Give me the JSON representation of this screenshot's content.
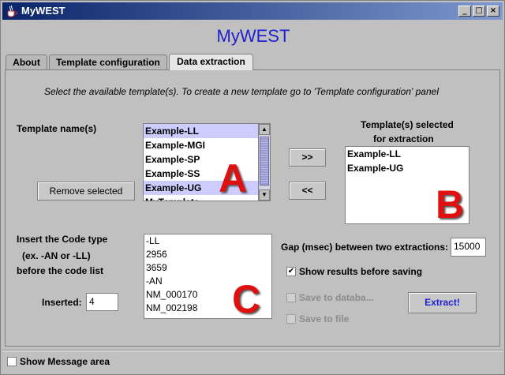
{
  "window": {
    "title": "MyWEST",
    "controls": {
      "minimize": "_",
      "maximize": "□",
      "close": "×"
    }
  },
  "header": {
    "app_title": "MyWEST"
  },
  "tabs": [
    {
      "label": "About"
    },
    {
      "label": "Template configuration"
    },
    {
      "label": "Data extraction",
      "active": true
    }
  ],
  "panel": {
    "instruction": "Select the available template(s). To create a new template go to 'Template configuration' panel",
    "template_names_label": "Template name(s)",
    "templates": [
      "Example-LL",
      "Example-MGI",
      "Example-SP",
      "Example-SS",
      "Example-UG",
      "MyTemplate"
    ],
    "selected_templates_in_source": [
      "Example-LL",
      "Example-UG"
    ],
    "remove_button": "Remove selected",
    "add_button": ">>",
    "remove_arrow_button": "<<",
    "selected_header_line1": "Template(s)  selected",
    "selected_header_line2": "for extraction",
    "selected_list": [
      "Example-LL",
      "Example-UG"
    ],
    "code_label_line1": "Insert the Code type",
    "code_label_line2": "(ex. -AN or -LL)",
    "code_label_line3": "before the code list",
    "code_list": [
      "-LL",
      "2956",
      "3659",
      "-AN",
      "NM_000170",
      "NM_002198"
    ],
    "inserted_label": "Inserted:",
    "inserted_value": "4",
    "gap_label": "Gap (msec) between two extractions:",
    "gap_value": "15000",
    "show_results_label": "Show results before saving",
    "show_results_checked": true,
    "save_db_label": "Save to databa...",
    "save_file_label": "Save to file",
    "extract_button": "Extract!"
  },
  "footer": {
    "show_message_label": "Show Message area"
  },
  "overlays": {
    "a": "A",
    "b": "B",
    "c": "C"
  },
  "colors": {
    "title_blue": "#1f1fd0",
    "selection": "#ccccff",
    "overlay_red": "#e01010",
    "extract_text": "#1f1fd0"
  }
}
